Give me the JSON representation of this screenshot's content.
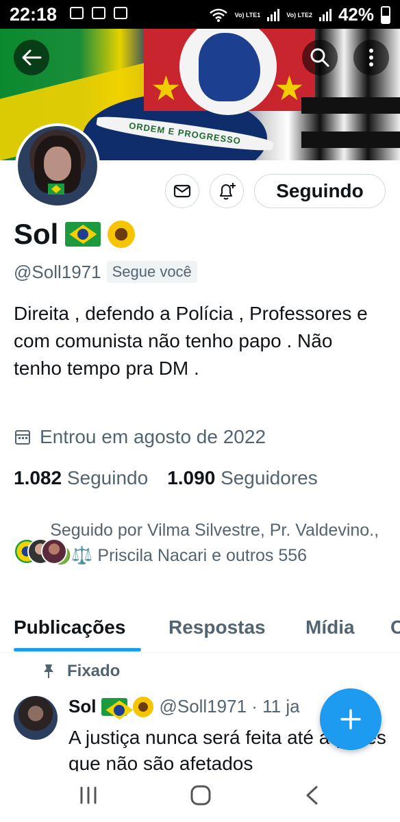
{
  "status_bar": {
    "time": "22:18",
    "battery": "42%",
    "lte1": "Vo) LTE1",
    "lte2": "Vo) LTE2"
  },
  "banner": {
    "motto": "ORDEM E PROGRESSO"
  },
  "profile": {
    "name": "Sol",
    "handle": "@Soll1971",
    "follows_you": "Segue você",
    "bio": "Direita , defendo a Polícia , Professores e com comunista não tenho papo . Não tenho tempo pra DM .",
    "joined": "Entrou em agosto de 2022",
    "following_count": "1.082",
    "following_label": "Seguindo",
    "followers_count": "1.090",
    "followers_label": "Seguidores",
    "followed_by": "Seguido por Vilma Silvestre, Pr. Valdevino., 🟢⚖️ Priscila Nacari e outros 556"
  },
  "buttons": {
    "following": "Seguindo"
  },
  "tabs": [
    {
      "label": "Publicações"
    },
    {
      "label": "Respostas"
    },
    {
      "label": "Mídia"
    },
    {
      "label": "C"
    }
  ],
  "pinned_post": {
    "pinned_label": "Fixado",
    "author": "Sol",
    "handle_date": "@Soll1971 · 11 ja",
    "text": "A justiça nunca será feita até aqueles que não são afetados"
  },
  "colors": {
    "accent": "#1d9bf0",
    "secondary_text": "#536471",
    "primary_text": "#0f1419"
  }
}
